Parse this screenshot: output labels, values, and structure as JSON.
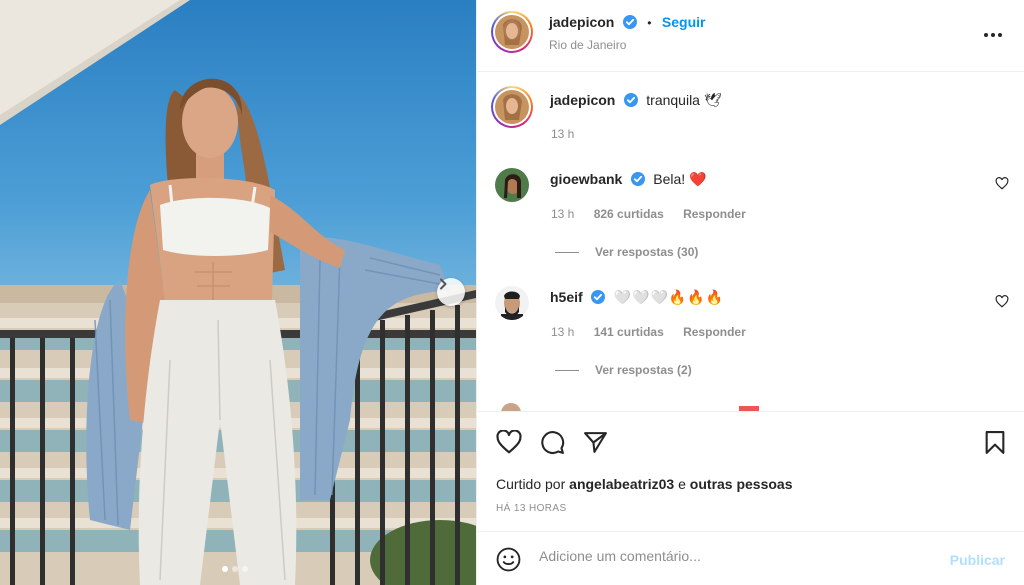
{
  "post": {
    "author": "jadepicon",
    "location": "Rio de Janeiro",
    "follow_label": "Seguir",
    "separator": "•",
    "more_icon": "more-horizontal-icon",
    "caption_author": "jadepicon",
    "caption_text": "tranquila 🕊",
    "caption_time": "13 h",
    "carousel": {
      "slides": 3,
      "current": 1
    }
  },
  "comments": [
    {
      "author": "gioewbank",
      "text": "Bela! ❤️",
      "time": "13 h",
      "likes": "826 curtidas",
      "reply_label": "Responder",
      "view_replies": "Ver respostas (30)"
    },
    {
      "author": "h5eif",
      "text": "🤍🤍🤍🔥🔥🔥",
      "time": "13 h",
      "likes": "141 curtidas",
      "reply_label": "Responder",
      "view_replies": "Ver respostas (2)"
    }
  ],
  "actions": {
    "liked_by_prefix": "Curtido por",
    "liked_by_user": "angelabeatriz03",
    "liked_by_conj": "e",
    "liked_by_others": "outras pessoas",
    "time_ago": "HÁ 13 HORAS"
  },
  "add_comment": {
    "placeholder": "Adicione um comentário...",
    "publish_label": "Publicar"
  },
  "colors": {
    "link_blue": "#0095f6",
    "publish_disabled": "#b2dffc",
    "verified_blue": "#3897f0",
    "heart_red": "#ed4956"
  }
}
